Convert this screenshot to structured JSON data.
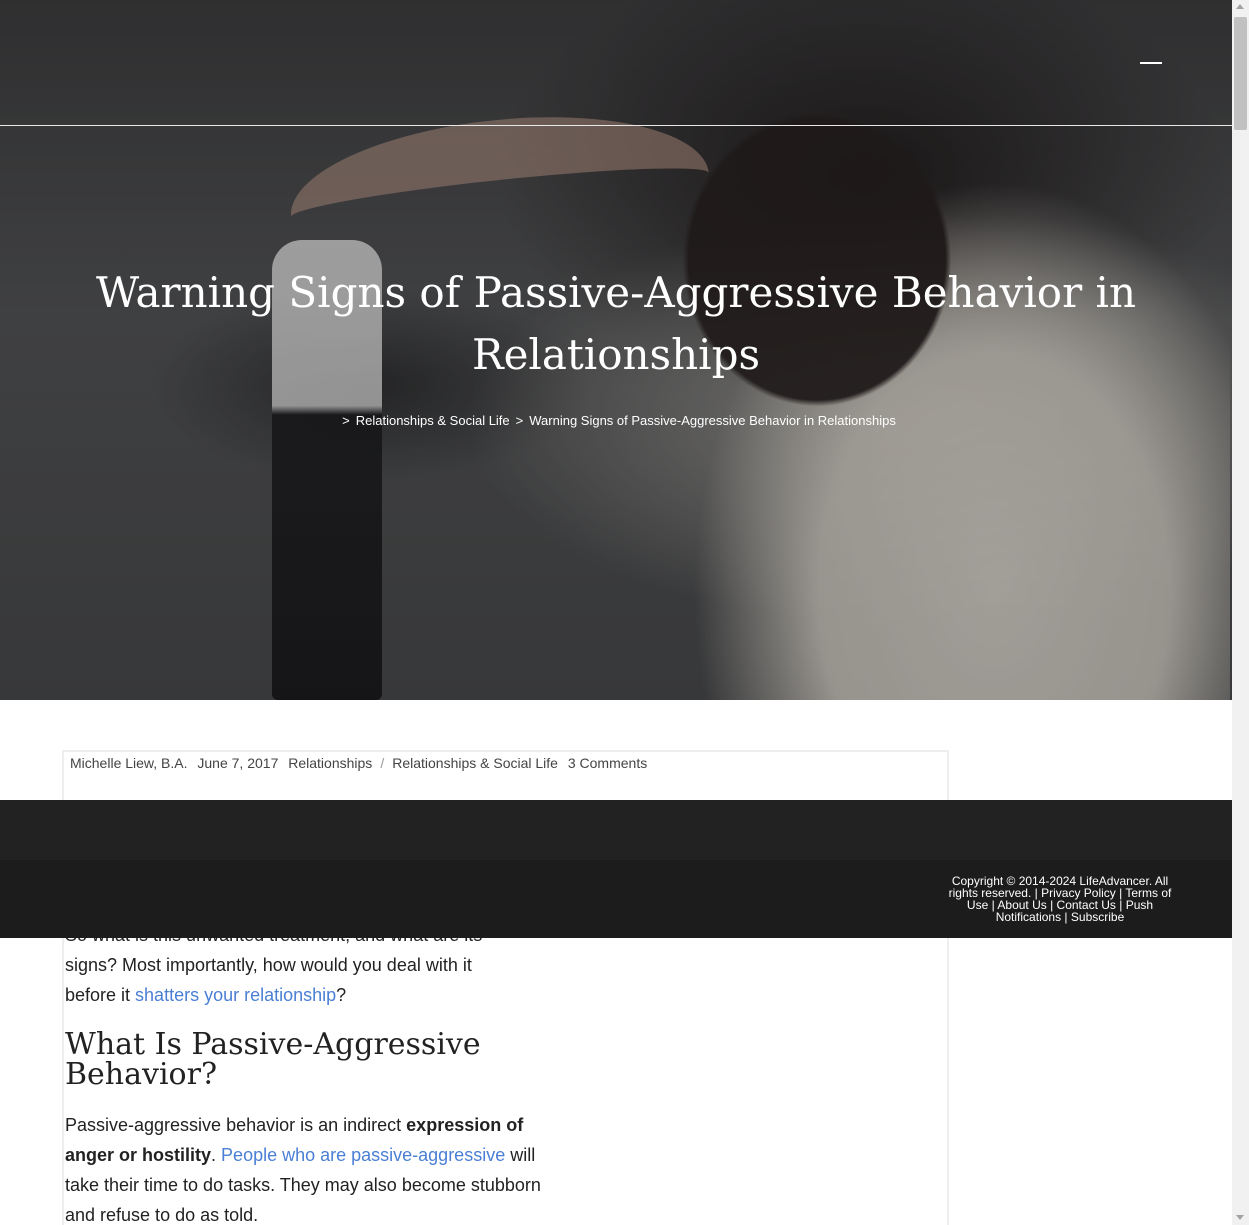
{
  "header": {
    "menu_icon": "hamburger-menu-icon"
  },
  "hero": {
    "title": "Warning Signs of Passive-Aggressive Behavior in Relationships",
    "breadcrumb": {
      "separator": ">",
      "items": [
        "Relationships & Social Life",
        "Warning Signs of Passive-Aggressive Behavior in Relationships"
      ]
    }
  },
  "meta": {
    "author": "Michelle Liew, B.A.",
    "date": "June 7, 2017",
    "category_1": "Relationships",
    "slash": "/",
    "category_2": "Relationships & Social Life",
    "comments": "3 Comments"
  },
  "footer": {
    "copyright": "Copyright © 2014-2024 LifeAdvancer. All rights reserved.",
    "links": [
      "Privacy Policy",
      "Terms of Use",
      "About Us",
      "Contact Us",
      "Push Notifications",
      "Subscribe"
    ],
    "separator": " | "
  },
  "article": {
    "partial_line": "So what is this unwanted treatment, and what are its",
    "para1_line2": "signs? Most importantly, how would you deal with it",
    "para1_line3_before": "before it ",
    "para1_link": "shatters your relationship",
    "para1_line3_after": "?",
    "heading": "What Is Passive-Aggressive Behavior?",
    "para2_start": "Passive-aggressive behavior is an indirect ",
    "para2_bold": "expression of anger or hostility",
    "para2_after_bold": ". ",
    "para2_link": "People who are passive-aggressive",
    "para2_rest": " will take their time to do tasks. They may also become stubborn and refuse to do as told."
  },
  "colors": {
    "link": "#4a7fd4",
    "footer_dark": "#1c1c1c",
    "text": "#222222"
  }
}
